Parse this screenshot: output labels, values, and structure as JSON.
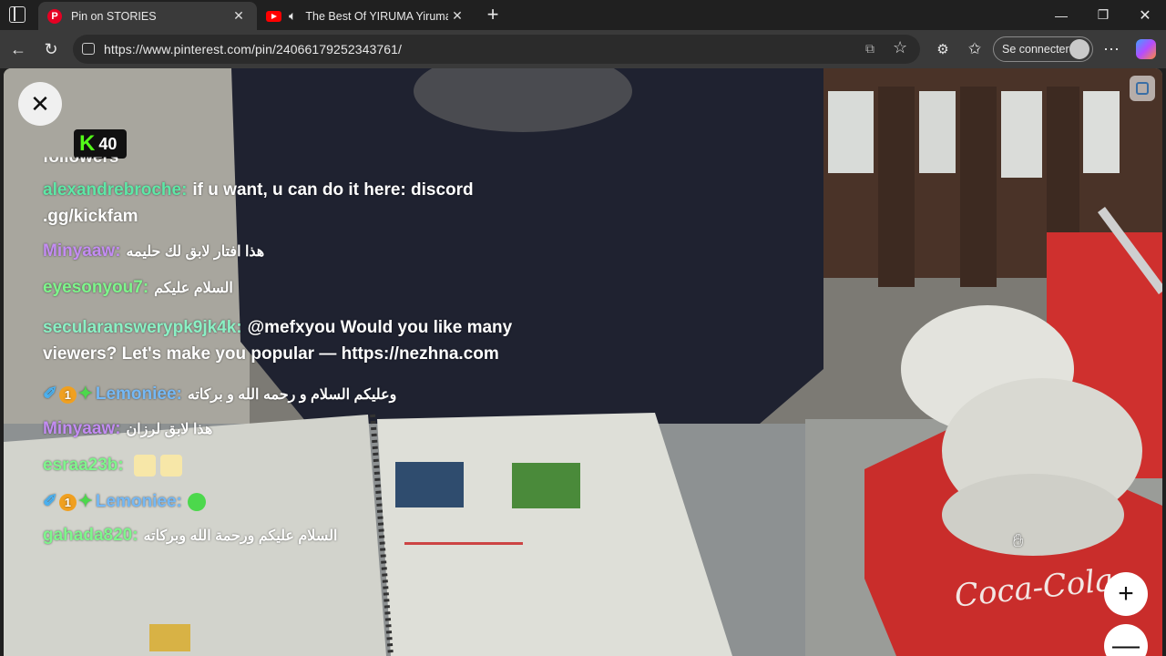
{
  "tabs": [
    {
      "title": "Pin on STORIES",
      "favicon": "pinterest-icon",
      "active": true
    },
    {
      "title": "The Best Of YIRUMA Yiruma'",
      "favicon": "youtube-icon",
      "active": false
    }
  ],
  "address": {
    "url": "https://www.pinterest.com/pin/24066179252343761/"
  },
  "signin": {
    "label": "Se connecter"
  },
  "badge": {
    "count": "40",
    "logo": "K"
  },
  "chat": [
    {
      "user": "followers",
      "text": "",
      "color": "#ffffff"
    },
    {
      "user": "alexandrebroche:",
      "text": "if u want, u can do it here: discord",
      "text2": ".gg/kickfam",
      "color": "#5ee7a6"
    },
    {
      "user": "Minyaaw:",
      "text": "هذا افتار لابق لك حليمه",
      "color": "#c38cf2"
    },
    {
      "user": "eyesonyou7:",
      "text": "السلام عليكم",
      "color": "#7ef58b"
    },
    {
      "user": "secularanswerypk9jk4k:",
      "text": "@mefxyou Would you like many",
      "text2": "viewers? Let's make you popular — https://nezhna.com",
      "color": "#8af0c4"
    },
    {
      "user": "Lemoniee:",
      "text": "وعليكم السلام و رحمه الله و بركاته",
      "color": "#74b8f5"
    },
    {
      "user": "Minyaaw:",
      "text": "هذا لابق لرزان",
      "color": "#c38cf2"
    },
    {
      "user": "esraa23b:",
      "text": "",
      "color": "#7ef58b"
    },
    {
      "user": "Lemoniee:",
      "text": "",
      "color": "#74b8f5"
    },
    {
      "user": "gahada820:",
      "text": "السلام عليكم ورحمة الله وبركاته",
      "color": "#7ef58b"
    }
  ],
  "colors": {
    "accent": "#53fc18",
    "tabbar": "#202020",
    "toolbar": "#3a3a3a"
  }
}
